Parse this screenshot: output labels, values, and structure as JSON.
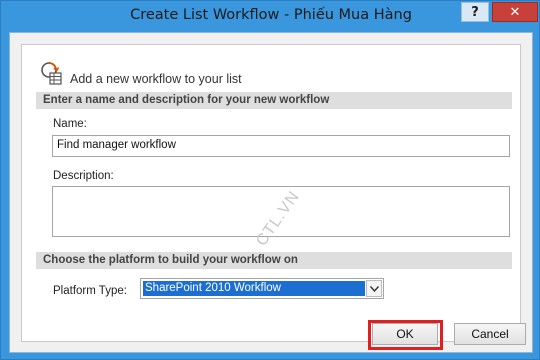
{
  "window": {
    "title": "Create List Workflow - Phiếu Mua Hàng",
    "help_label": "?",
    "close_label": "✕"
  },
  "header": {
    "text": "Add a new workflow to your list",
    "icon": "workflow-icon"
  },
  "section_name": {
    "title": "Enter a name and description for your new workflow",
    "name_label": "Name:",
    "name_value": "Find manager workflow",
    "description_label": "Description:",
    "description_value": ""
  },
  "section_platform": {
    "title": "Choose the platform to build your workflow on",
    "platform_label": "Platform Type:",
    "platform_value": "SharePoint 2010 Workflow",
    "dropdown_icon": "chevron-down-icon"
  },
  "buttons": {
    "ok_label": "OK",
    "cancel_label": "Cancel"
  },
  "watermark": "CTL.VN",
  "colors": {
    "title_bar": "#3a97de",
    "close_button": "#c7403a",
    "selection": "#1c6fd1",
    "highlight": "#e02020"
  }
}
